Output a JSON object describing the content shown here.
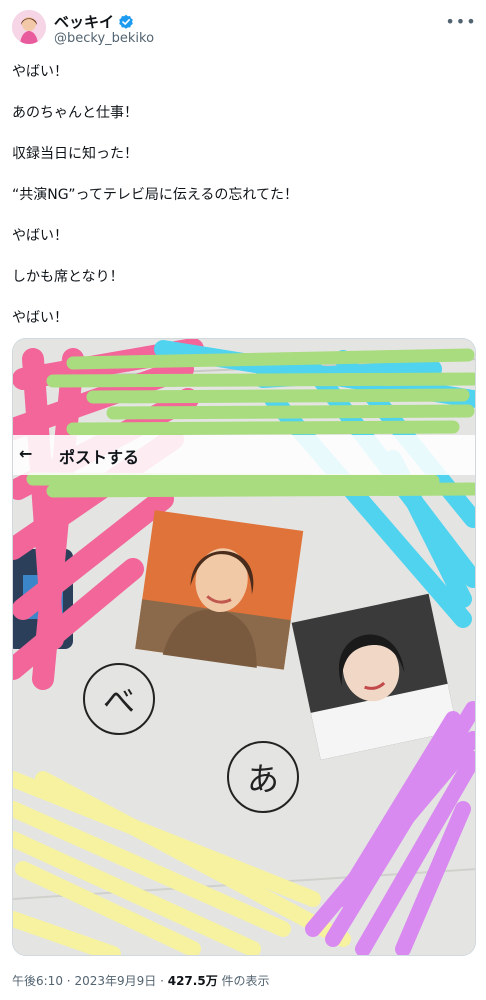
{
  "user": {
    "display_name": "ベッキイ",
    "handle": "@becky_bekiko",
    "verified": true,
    "avatar_icon": "avatar-photo"
  },
  "more_label": "•••",
  "tweet": {
    "lines": [
      "やばい！",
      "あのちゃんと仕事！",
      "収録当日に知った！",
      "“共演NG”ってテレビ局に伝えるの忘れてた！",
      "やばい！",
      "しかも席となり！",
      "やばい！"
    ]
  },
  "media": {
    "post_bar_back": "←",
    "post_bar_title": "ポストする",
    "kana_left": "べ",
    "kana_right": "あ",
    "colors": {
      "pink": "#f2669a",
      "blue": "#4fd3ef",
      "green": "#a9dc7e",
      "yellow": "#f6f2a0",
      "purple": "#d98af0",
      "photo_orange": "#e0733a"
    }
  },
  "meta": {
    "time": "午後6:10",
    "separator": "·",
    "date": "2023年9月9日",
    "views_count": "427.5万",
    "views_label": "件の表示"
  },
  "colors": {
    "text": "#0f1419",
    "muted": "#536471",
    "verified": "#1d9bf0"
  }
}
